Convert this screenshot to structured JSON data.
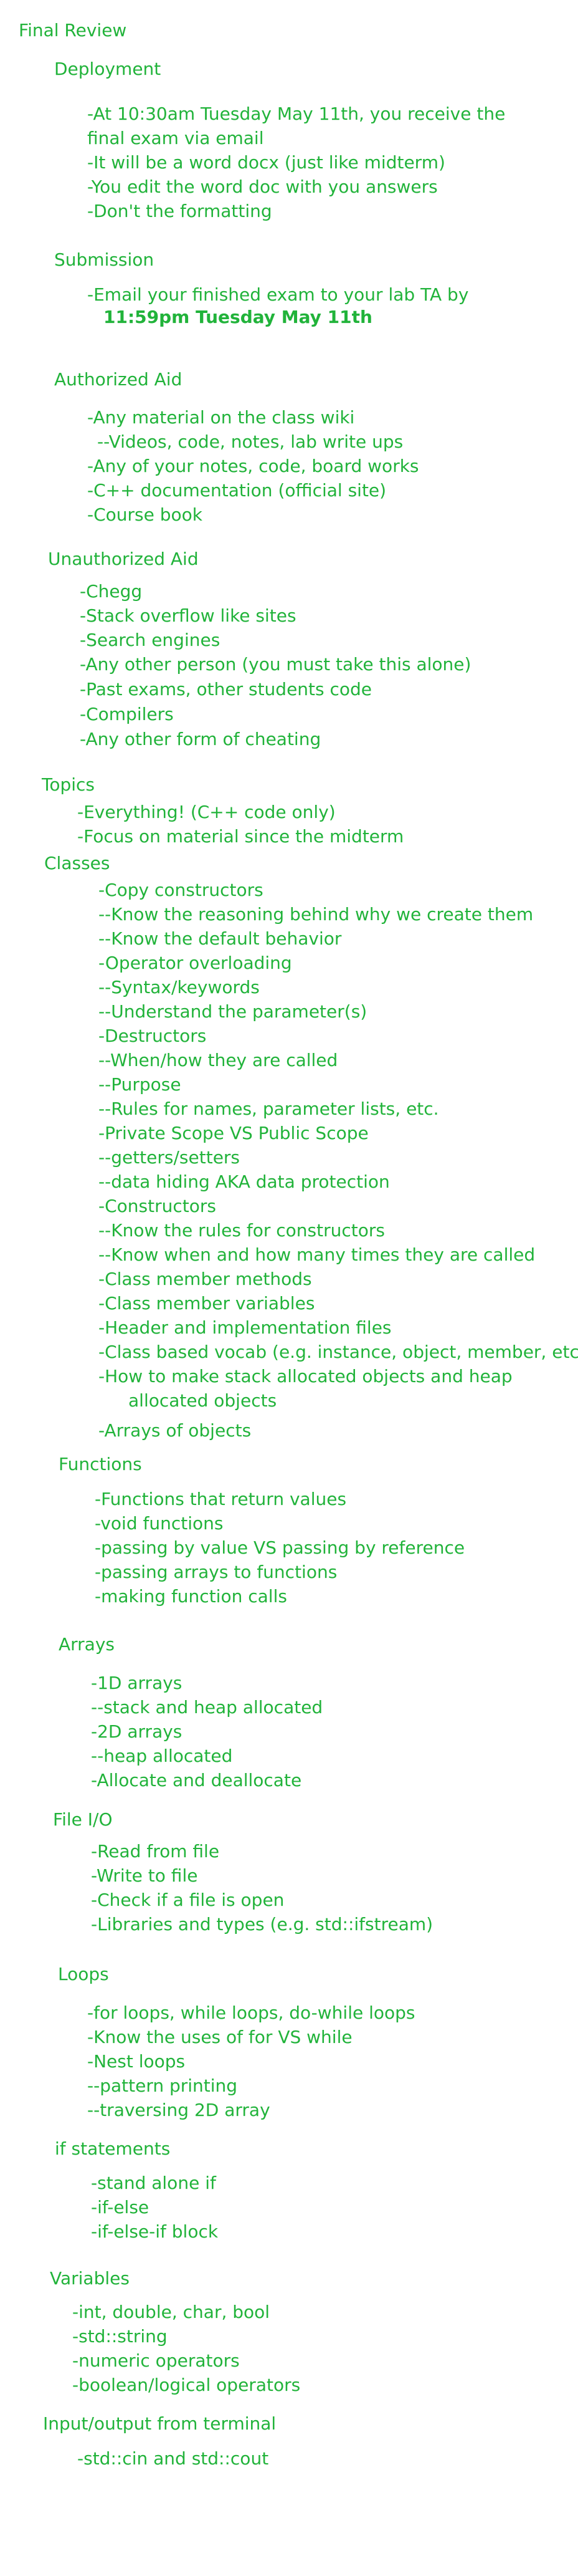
{
  "title": "Final Review",
  "deployment": {
    "heading": "Deployment",
    "lines": [
      "-At 10:30am Tuesday May 11th, you receive the",
      "final exam via email",
      "-It will be a word docx (just like midterm)",
      "-You edit the word doc with you answers",
      "-Don't the formatting"
    ]
  },
  "submission": {
    "heading": "Submission",
    "line": "-Email your finished exam to your lab TA by",
    "deadline": "11:59pm Tuesday May 11th"
  },
  "authorized": {
    "heading": "Authorized Aid",
    "lines": [
      "-Any material on the class wiki",
      "--Videos, code, notes, lab write ups",
      "-Any of your notes, code, board works",
      "-C++ documentation (official site)",
      "-Course book"
    ]
  },
  "unauthorized": {
    "heading": "Unauthorized Aid",
    "lines": [
      "-Chegg",
      "-Stack overflow like sites",
      "-Search engines",
      "-Any other person (you must take this alone)",
      "-Past exams, other students code",
      "-Compilers",
      "-Any other form of cheating"
    ]
  },
  "topics": {
    "heading": "Topics",
    "lines": [
      "-Everything! (C++ code only)",
      "-Focus on material since the midterm"
    ]
  },
  "classes": {
    "heading": "Classes",
    "lines": [
      "-Copy constructors",
      "--Know the reasoning behind why we create them",
      "--Know the default behavior",
      "-Operator overloading",
      "--Syntax/keywords",
      "--Understand the parameter(s)",
      "-Destructors",
      "--When/how they are called",
      "--Purpose",
      "--Rules for names, parameter lists, etc.",
      "-Private Scope VS Public Scope",
      "--getters/setters",
      "--data hiding AKA data protection",
      "-Constructors",
      "--Know the rules for constructors",
      "--Know when and how many times they are called",
      "-Class member methods",
      "-Class member variables",
      "-Header and implementation files",
      "-Class based vocab (e.g. instance, object, member, etc)",
      "-How to make stack allocated objects and heap",
      "allocated objects",
      "-Arrays of objects"
    ]
  },
  "functions": {
    "heading": "Functions",
    "lines": [
      "-Functions that return values",
      "-void functions",
      "-passing by value VS passing by reference",
      "-passing arrays to functions",
      "-making function calls"
    ]
  },
  "arrays": {
    "heading": "Arrays",
    "lines": [
      "-1D arrays",
      "--stack and heap allocated",
      "-2D arrays",
      "--heap allocated",
      "-Allocate and deallocate"
    ]
  },
  "fileio": {
    "heading": "File I/O",
    "lines": [
      "-Read from file",
      "-Write to file",
      "-Check if a file is open",
      "-Libraries and types (e.g. std::ifstream)"
    ]
  },
  "loops": {
    "heading": "Loops",
    "lines": [
      "-for loops, while loops, do-while loops",
      "-Know the uses of for VS while",
      "-Nest loops",
      "--pattern printing",
      "--traversing 2D array"
    ]
  },
  "ifs": {
    "heading": "if statements",
    "lines": [
      "-stand alone if",
      "-if-else",
      "-if-else-if block"
    ]
  },
  "variables": {
    "heading": "Variables",
    "lines": [
      "-int, double, char, bool",
      "-std::string",
      "-numeric operators",
      "-boolean/logical operators"
    ]
  },
  "io": {
    "heading": "Input/output from terminal",
    "lines": [
      "-std::cin and std::cout"
    ]
  }
}
